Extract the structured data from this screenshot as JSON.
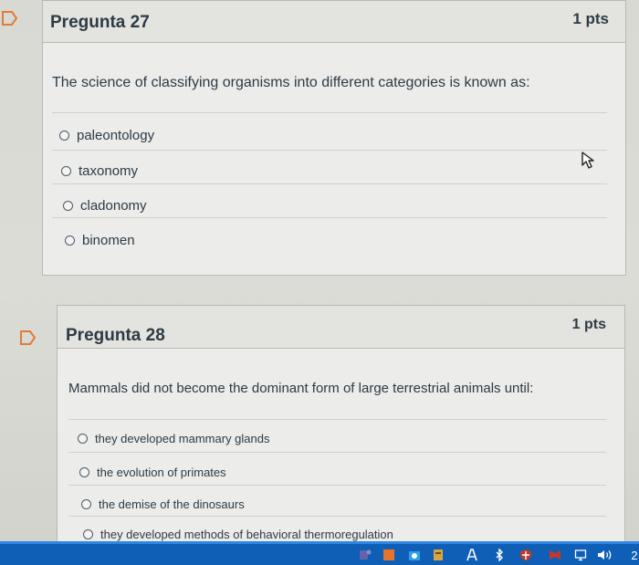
{
  "q27": {
    "title": "Pregunta 27",
    "points": "1 pts",
    "question": "The science of classifying organisms into different categories is known as:",
    "options": [
      "paleontology",
      "taxonomy",
      "cladonomy",
      "binomen"
    ]
  },
  "q28": {
    "title": "Pregunta 28",
    "points": "1 pts",
    "question": "Mammals did not become the dominant form of large terrestrial animals until:",
    "options": [
      "they developed mammary glands",
      "the evolution of primates",
      "the demise of the dinosaurs",
      "they developed methods of behavioral thermoregulation"
    ]
  },
  "taskbar": {
    "icons": [
      "teams-icon",
      "office-icon",
      "store-icon",
      "text-icon",
      "bluetooth-icon",
      "shield-icon",
      "mcafee-icon",
      "network-icon",
      "volume-icon"
    ],
    "clock_fragment": "2"
  },
  "colors": {
    "taskbar": "#0f5fb6",
    "flag": "#e07b39",
    "text": "#2d3b45"
  }
}
